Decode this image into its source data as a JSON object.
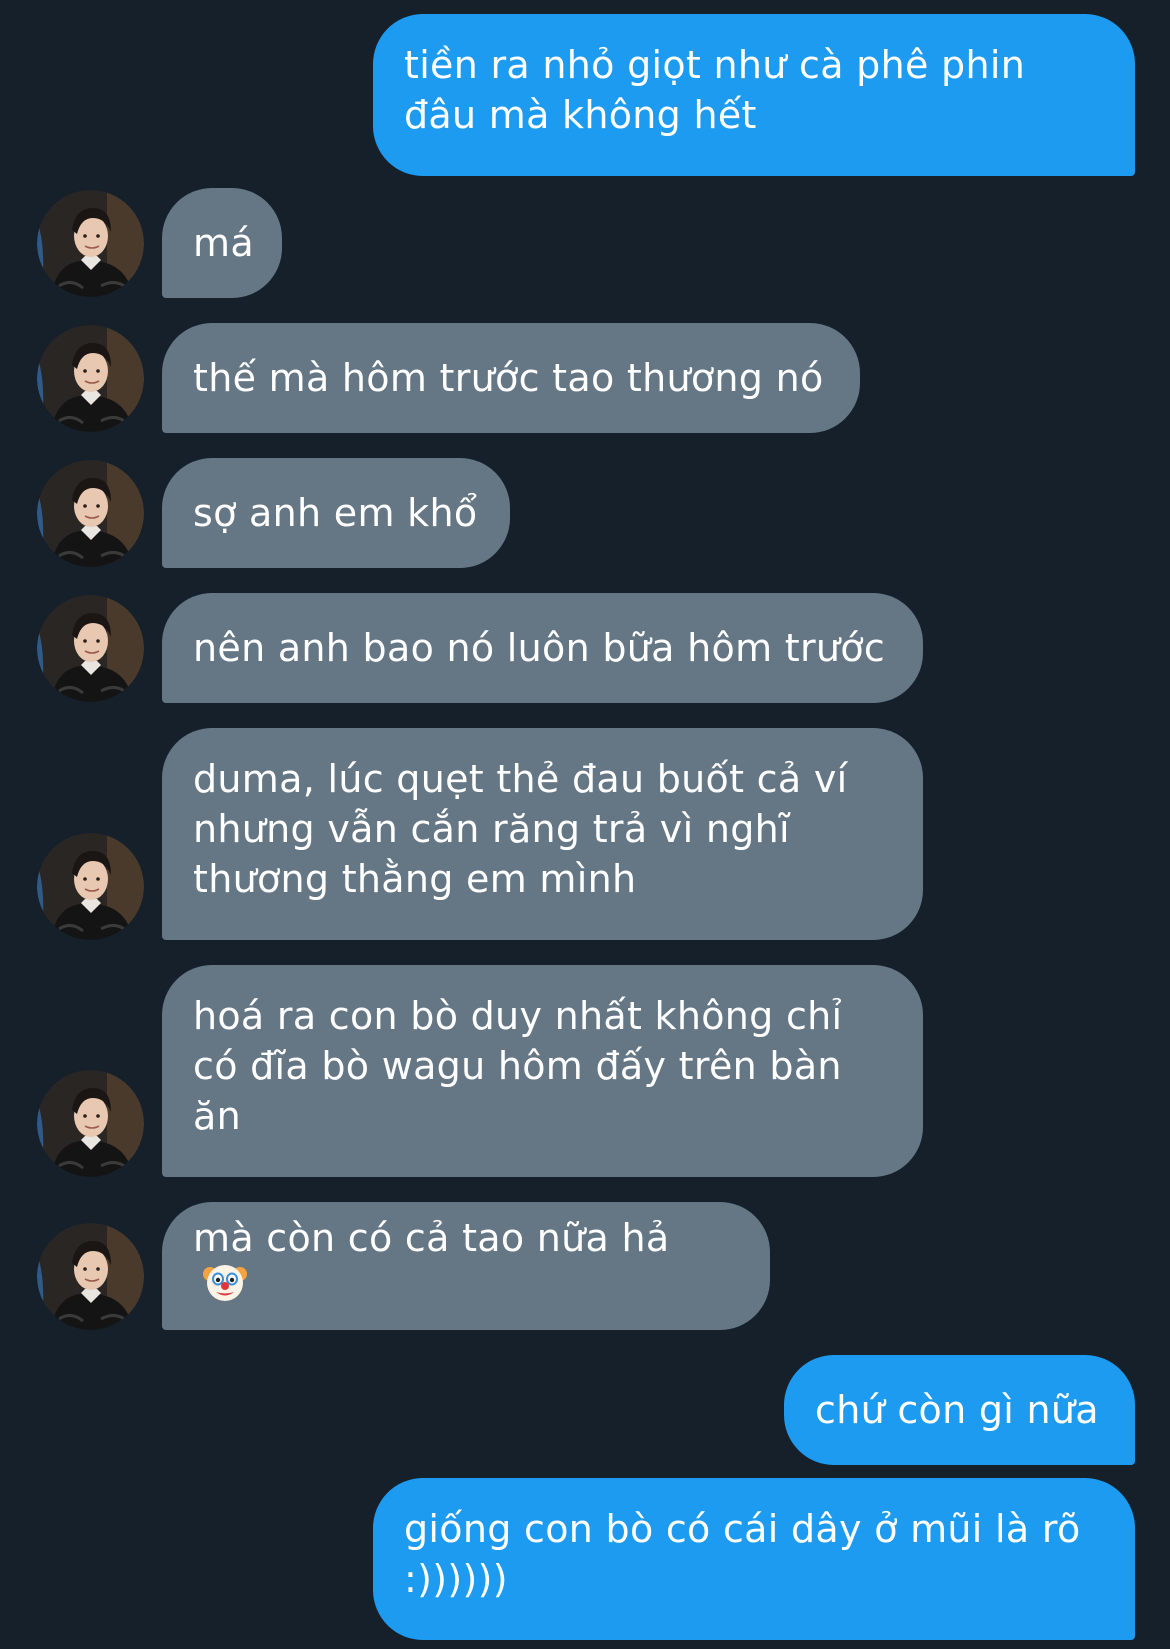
{
  "conversation": {
    "messages": [
      {
        "direction": "sent",
        "text": "tiền ra nhỏ giọt như cà phê phin đâu mà không hết"
      },
      {
        "direction": "received",
        "text": "má"
      },
      {
        "direction": "received",
        "text": "thế mà hôm trước tao thương nó"
      },
      {
        "direction": "received",
        "text": "sợ anh em khổ"
      },
      {
        "direction": "received",
        "text": "nên anh bao nó luôn bữa hôm trước"
      },
      {
        "direction": "received",
        "text": "duma, lúc quẹt thẻ đau buốt cả ví nhưng vẫn cắn răng trả vì nghĩ thương thằng em mình"
      },
      {
        "direction": "received",
        "text": "hoá ra con bò duy nhất không chỉ có đĩa bò wagu hôm đấy trên bàn ăn"
      },
      {
        "direction": "received",
        "text": "mà còn có cả tao nữa hả",
        "emoji": "clown-face-icon"
      },
      {
        "direction": "sent",
        "text": "chứ còn gì nữa"
      },
      {
        "direction": "sent",
        "text": "giống con bò có cái dây ở mũi là rõ :))))))"
      }
    ]
  },
  "colors": {
    "background": "#15202b",
    "sent_bubble": "#1d9bf0",
    "received_bubble": "#657685",
    "text": "#ffffff"
  }
}
